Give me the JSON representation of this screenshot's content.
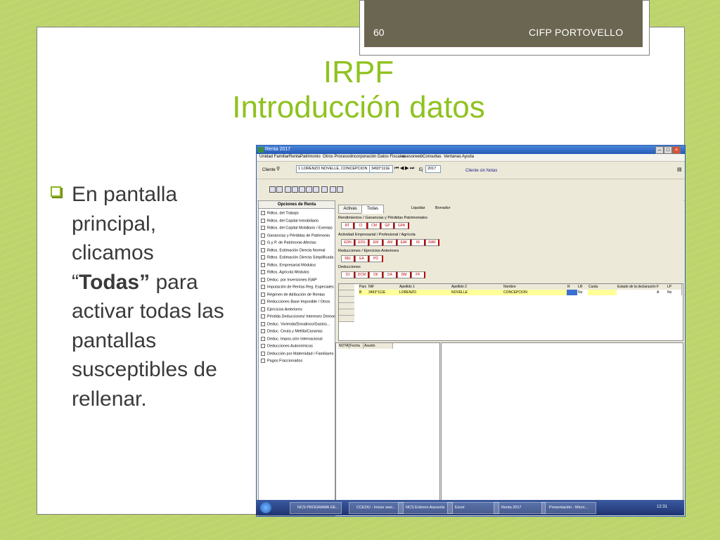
{
  "slide": {
    "number": "60",
    "organization": "CIFP PORTOVELLO",
    "title_line1": "IRPF",
    "title_line2": "Introducción datos",
    "bullet_before": "En pantalla principal, clicamos “",
    "bullet_bold": "Todas”",
    "bullet_after": " para activar todas las pantallas susceptibles de rellenar."
  },
  "colors": {
    "accent": "#8fc21f",
    "header_bg": "#6b6651",
    "background": "#bcd46b"
  },
  "app": {
    "window_title": "Renta 2017",
    "menu": [
      "Unidad Familiar",
      "Renta",
      "Patrimonio",
      "Otros Procesos",
      "Incorporación Datos Fiscales",
      "asesorweb",
      "Consultas",
      "Ventanas",
      "Ayuda"
    ],
    "client_label": "Cliente",
    "client_name": "1 LORENZO NOVELLE, CONCEPCION",
    "client_nif": "3493°111E",
    "year_label": "Ej",
    "year": "2017",
    "status_text": "Cliente sin Notas",
    "left_panel_title": "Opciones de Renta",
    "left_items": [
      "Rdtos. del Trabajo",
      "Rdtos. del Capital Inmobiliario",
      "Rdtos. del Capital Mobiliario / Exentas",
      "Ganancias y Pérdidas de Patrimonio",
      "G.y P. de Patrimonio Afectas",
      "Rdtos. Estimación Directa Normal",
      "Rdtos. Estimación Directa Simplificada",
      "Rdtos. Empresarial Módulos",
      "Rdtos. Agrícola Módulos",
      "Deduc. por Inversiones EIAP",
      "Imputación de Rentas Reg. Especiales",
      "Régimen de Atribución de Rentas",
      "Reducciones Base Imponible / Otros",
      "Ejercicios Anteriores",
      "Pérdida Deducciones/ Intereses Demora",
      "Deduc. Vivienda/Donativos/Gastos...",
      "Deduc. Ceuta y Melilla/Canarias",
      "Deduc. Impos.ción Internacional",
      "Deducciones Autonómicas",
      "Deducción por Maternidad / Familiares",
      "Pagos Fraccionados"
    ],
    "tabs": [
      "Activas",
      "Todas"
    ],
    "tool_links": [
      "Liquidar",
      "Borrador"
    ],
    "group1_label": "Rendimientos / Ganancias y Pérdidas Patrimoniales",
    "group1_buttons": [
      "RT",
      "CI",
      "CM",
      "GP",
      "GPA"
    ],
    "group2_label": "Actividad Empresarial / Profesional / Agrícola",
    "group2_buttons": [
      "EDN",
      "EDS",
      "EM",
      "AM",
      "EAF",
      "IR",
      "RAR"
    ],
    "group3_label": "Reducciones / Ejercicios Anteriores",
    "group3_buttons": [
      "REI",
      "EA",
      "PD"
    ],
    "group4_label": "Deducciones",
    "group4_buttons": [
      "DI",
      "DCM",
      "DII",
      "DA",
      "DM",
      "PF"
    ],
    "grid_headers": [
      "Parc",
      "NIF",
      "Apellido 1",
      "Apellido 2",
      "Nombre",
      "R",
      "LR",
      "Cuota",
      "Estado de la declaración",
      "F",
      "LP"
    ],
    "grid_row": [
      "B",
      "3493°111E",
      "LORENZO",
      "NOVELLE",
      "CONCEPCION",
      "",
      "No",
      "",
      "",
      "A",
      "No"
    ],
    "notes_headers": [
      "NOTAS",
      "Fecha",
      "Asunto"
    ],
    "taskbar": [
      "NCS PROGRAMA GE...",
      "CCEOU - Iniciar sesi...",
      "NCS Entorno Asesoría",
      "Excel",
      "Renta 2017",
      "Presentación - Micro..."
    ],
    "clock": "12:31"
  }
}
